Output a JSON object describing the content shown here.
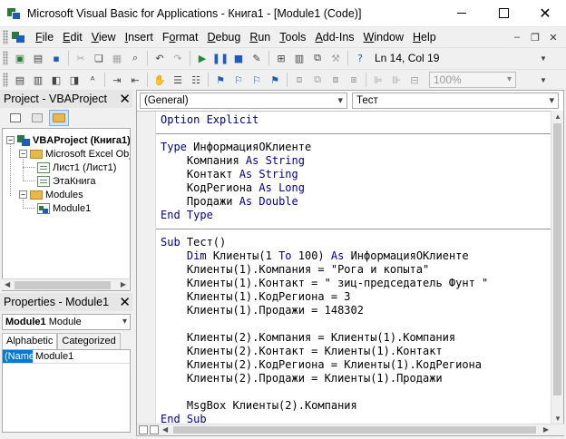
{
  "window": {
    "title": "Microsoft Visual Basic for Applications - Книга1 - [Module1 (Code)]"
  },
  "menu": {
    "items": [
      {
        "u": "F",
        "rest": "ile"
      },
      {
        "u": "E",
        "rest": "dit"
      },
      {
        "u": "V",
        "rest": "iew"
      },
      {
        "u": "I",
        "rest": "nsert"
      },
      {
        "u": "",
        "pre": "F",
        "u2": "o",
        "rest": "rmat"
      },
      {
        "u": "D",
        "rest": "ebug"
      },
      {
        "u": "R",
        "rest": "un"
      },
      {
        "u": "T",
        "rest": "ools"
      },
      {
        "u": "A",
        "rest": "dd-Ins"
      },
      {
        "u": "W",
        "rest": "indow"
      },
      {
        "u": "H",
        "rest": "elp"
      }
    ]
  },
  "toolbar": {
    "position": "Ln 14, Col 19",
    "zoom": "100%"
  },
  "project_pane": {
    "title": "Project - VBAProject",
    "tree": {
      "root": "VBAProject (Книга1)",
      "objects_folder": "Microsoft Excel Obje",
      "sheet1": "Лист1 (Лист1)",
      "workbook": "ЭтаКнига",
      "modules_folder": "Modules",
      "module1": "Module1"
    }
  },
  "properties_pane": {
    "title": "Properties - Module1",
    "object_bold": "Module1",
    "object_type": "Module",
    "tabs": [
      "Alphabetic",
      "Categorized"
    ],
    "rows": [
      {
        "name": "(Name)",
        "value": "Module1"
      }
    ]
  },
  "code_window": {
    "object_combo": "(General)",
    "procedure_combo": "Тест",
    "lines": [
      "Option Explicit",
      "",
      "Type ИнформацияОКлиенте",
      "    Компания As String",
      "    Контакт As String",
      "    КодРегиона As Long",
      "    Продажи As Double",
      "End Type",
      "",
      "Sub Тест()",
      "    Dim Клиенты(1 To 100) As ИнформацияОКлиенте",
      "    Клиенты(1).Компания = \"Рога и копыта\"",
      "    Клиенты(1).Контакт = \" зиц-председатель Фунт \"",
      "    Клиенты(1).КодРегиона = 3",
      "    Клиенты(1).Продажи = 148302",
      "",
      "    Клиенты(2).Компания = Клиенты(1).Компания",
      "    Клиенты(2).Контакт = Клиенты(1).Контакт",
      "    Клиенты(2).КодРегиона = Клиенты(1).КодРегиона",
      "    Клиенты(2).Продажи = Клиенты(1).Продажи",
      "",
      "    MsgBox Клиенты(2).Компания",
      "End Sub"
    ]
  },
  "colors": {
    "keyword": "#00008b",
    "selection": "#0078d7"
  }
}
